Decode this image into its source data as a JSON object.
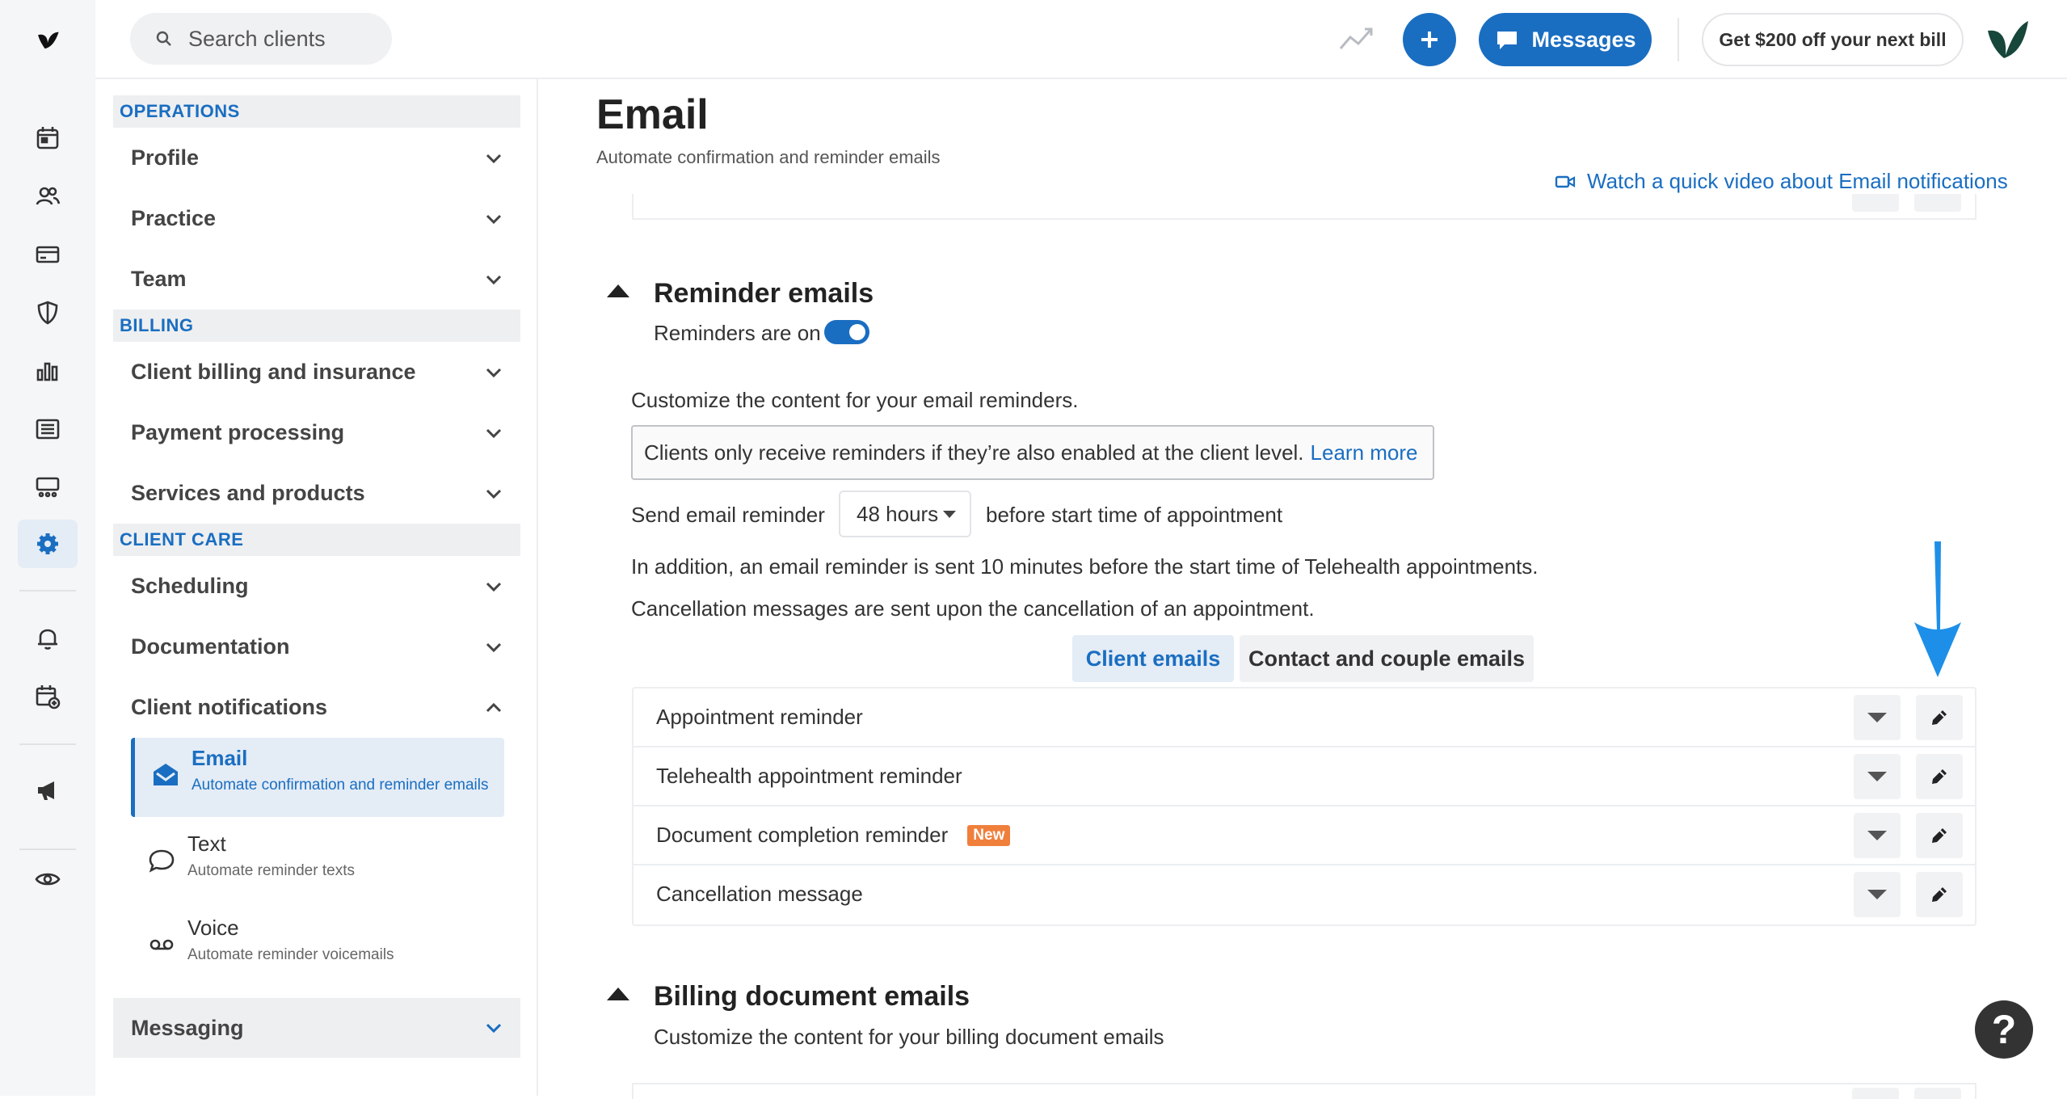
{
  "topbar": {
    "search_placeholder": "Search clients",
    "messages_label": "Messages",
    "promo_label": "Get $200 off your next bill"
  },
  "sidebar": {
    "sections": [
      {
        "title": "OPERATIONS",
        "items": [
          "Profile",
          "Practice",
          "Team"
        ]
      },
      {
        "title": "BILLING",
        "items": [
          "Client billing and insurance",
          "Payment processing",
          "Services and products"
        ]
      },
      {
        "title": "CLIENT CARE",
        "items": [
          "Scheduling",
          "Documentation",
          "Client notifications"
        ]
      }
    ],
    "notification_subitems": [
      {
        "title": "Email",
        "desc": "Automate confirmation and reminder emails"
      },
      {
        "title": "Text",
        "desc": "Automate reminder texts"
      },
      {
        "title": "Voice",
        "desc": "Automate reminder voicemails"
      }
    ],
    "messaging": "Messaging"
  },
  "page": {
    "title": "Email",
    "subtitle": "Automate confirmation and reminder emails",
    "video_link": "Watch a quick video about Email notifications"
  },
  "reminders": {
    "title": "Reminder emails",
    "status_label": "Reminders are on",
    "customize_text": "Customize the content for your email reminders.",
    "info_text": "Clients only receive reminders if they’re also enabled at the client level.",
    "info_link": "Learn more",
    "send_prefix": "Send email reminder",
    "send_value": "48 hours",
    "send_suffix": "before start time of appointment",
    "telehealth_note": "In addition, an email reminder is sent 10 minutes before the start time of Telehealth appointments.",
    "cancellation_note": "Cancellation messages are sent upon the cancellation of an appointment.",
    "tabs": [
      "Client emails",
      "Contact and couple emails"
    ],
    "rows": [
      {
        "label": "Appointment reminder",
        "badge": ""
      },
      {
        "label": "Telehealth appointment reminder",
        "badge": ""
      },
      {
        "label": "Document completion reminder",
        "badge": "New"
      },
      {
        "label": "Cancellation message",
        "badge": ""
      }
    ]
  },
  "billing_docs": {
    "title": "Billing document emails",
    "subtitle": "Customize the content for your billing document emails"
  },
  "help_label": "?",
  "colors": {
    "accent": "#1a6ec1",
    "badge": "#f07f3c",
    "arrow": "#1e8fe8"
  }
}
